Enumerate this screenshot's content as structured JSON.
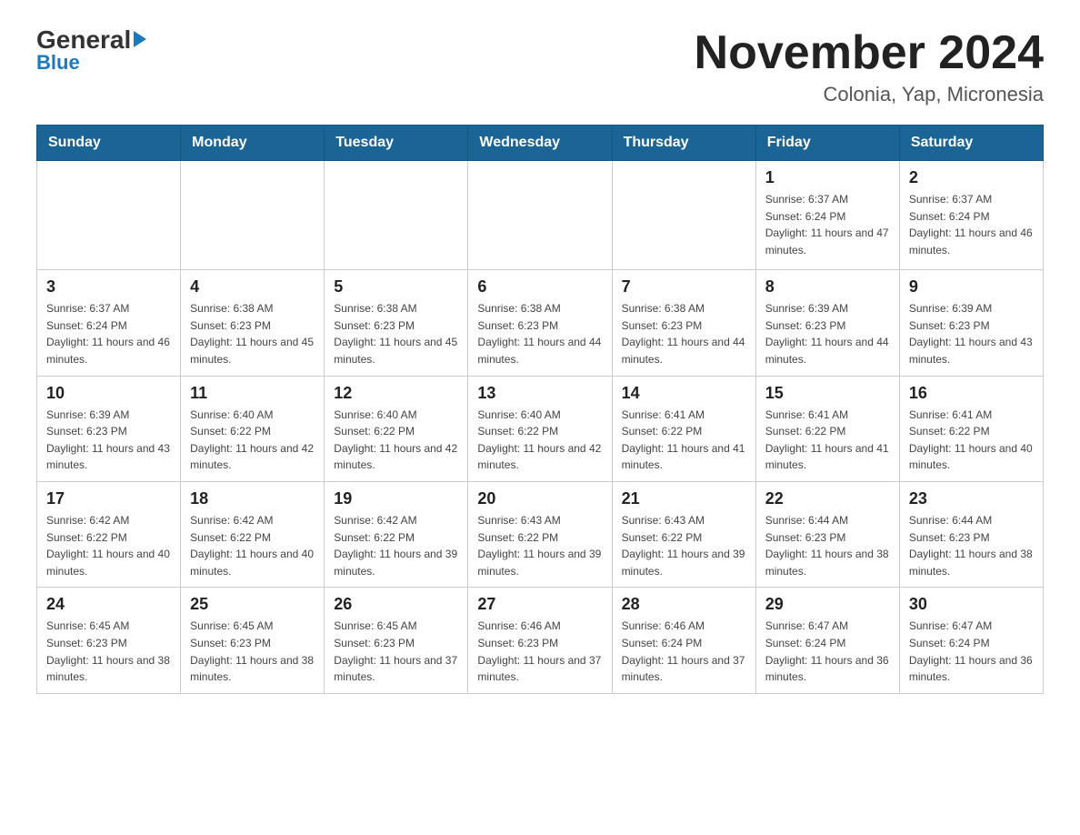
{
  "logo": {
    "general": "General",
    "blue": "Blue"
  },
  "title": "November 2024",
  "subtitle": "Colonia, Yap, Micronesia",
  "days_of_week": [
    "Sunday",
    "Monday",
    "Tuesday",
    "Wednesday",
    "Thursday",
    "Friday",
    "Saturday"
  ],
  "weeks": [
    [
      {
        "day": "",
        "info": ""
      },
      {
        "day": "",
        "info": ""
      },
      {
        "day": "",
        "info": ""
      },
      {
        "day": "",
        "info": ""
      },
      {
        "day": "",
        "info": ""
      },
      {
        "day": "1",
        "info": "Sunrise: 6:37 AM\nSunset: 6:24 PM\nDaylight: 11 hours and 47 minutes."
      },
      {
        "day": "2",
        "info": "Sunrise: 6:37 AM\nSunset: 6:24 PM\nDaylight: 11 hours and 46 minutes."
      }
    ],
    [
      {
        "day": "3",
        "info": "Sunrise: 6:37 AM\nSunset: 6:24 PM\nDaylight: 11 hours and 46 minutes."
      },
      {
        "day": "4",
        "info": "Sunrise: 6:38 AM\nSunset: 6:23 PM\nDaylight: 11 hours and 45 minutes."
      },
      {
        "day": "5",
        "info": "Sunrise: 6:38 AM\nSunset: 6:23 PM\nDaylight: 11 hours and 45 minutes."
      },
      {
        "day": "6",
        "info": "Sunrise: 6:38 AM\nSunset: 6:23 PM\nDaylight: 11 hours and 44 minutes."
      },
      {
        "day": "7",
        "info": "Sunrise: 6:38 AM\nSunset: 6:23 PM\nDaylight: 11 hours and 44 minutes."
      },
      {
        "day": "8",
        "info": "Sunrise: 6:39 AM\nSunset: 6:23 PM\nDaylight: 11 hours and 44 minutes."
      },
      {
        "day": "9",
        "info": "Sunrise: 6:39 AM\nSunset: 6:23 PM\nDaylight: 11 hours and 43 minutes."
      }
    ],
    [
      {
        "day": "10",
        "info": "Sunrise: 6:39 AM\nSunset: 6:23 PM\nDaylight: 11 hours and 43 minutes."
      },
      {
        "day": "11",
        "info": "Sunrise: 6:40 AM\nSunset: 6:22 PM\nDaylight: 11 hours and 42 minutes."
      },
      {
        "day": "12",
        "info": "Sunrise: 6:40 AM\nSunset: 6:22 PM\nDaylight: 11 hours and 42 minutes."
      },
      {
        "day": "13",
        "info": "Sunrise: 6:40 AM\nSunset: 6:22 PM\nDaylight: 11 hours and 42 minutes."
      },
      {
        "day": "14",
        "info": "Sunrise: 6:41 AM\nSunset: 6:22 PM\nDaylight: 11 hours and 41 minutes."
      },
      {
        "day": "15",
        "info": "Sunrise: 6:41 AM\nSunset: 6:22 PM\nDaylight: 11 hours and 41 minutes."
      },
      {
        "day": "16",
        "info": "Sunrise: 6:41 AM\nSunset: 6:22 PM\nDaylight: 11 hours and 40 minutes."
      }
    ],
    [
      {
        "day": "17",
        "info": "Sunrise: 6:42 AM\nSunset: 6:22 PM\nDaylight: 11 hours and 40 minutes."
      },
      {
        "day": "18",
        "info": "Sunrise: 6:42 AM\nSunset: 6:22 PM\nDaylight: 11 hours and 40 minutes."
      },
      {
        "day": "19",
        "info": "Sunrise: 6:42 AM\nSunset: 6:22 PM\nDaylight: 11 hours and 39 minutes."
      },
      {
        "day": "20",
        "info": "Sunrise: 6:43 AM\nSunset: 6:22 PM\nDaylight: 11 hours and 39 minutes."
      },
      {
        "day": "21",
        "info": "Sunrise: 6:43 AM\nSunset: 6:22 PM\nDaylight: 11 hours and 39 minutes."
      },
      {
        "day": "22",
        "info": "Sunrise: 6:44 AM\nSunset: 6:23 PM\nDaylight: 11 hours and 38 minutes."
      },
      {
        "day": "23",
        "info": "Sunrise: 6:44 AM\nSunset: 6:23 PM\nDaylight: 11 hours and 38 minutes."
      }
    ],
    [
      {
        "day": "24",
        "info": "Sunrise: 6:45 AM\nSunset: 6:23 PM\nDaylight: 11 hours and 38 minutes."
      },
      {
        "day": "25",
        "info": "Sunrise: 6:45 AM\nSunset: 6:23 PM\nDaylight: 11 hours and 38 minutes."
      },
      {
        "day": "26",
        "info": "Sunrise: 6:45 AM\nSunset: 6:23 PM\nDaylight: 11 hours and 37 minutes."
      },
      {
        "day": "27",
        "info": "Sunrise: 6:46 AM\nSunset: 6:23 PM\nDaylight: 11 hours and 37 minutes."
      },
      {
        "day": "28",
        "info": "Sunrise: 6:46 AM\nSunset: 6:24 PM\nDaylight: 11 hours and 37 minutes."
      },
      {
        "day": "29",
        "info": "Sunrise: 6:47 AM\nSunset: 6:24 PM\nDaylight: 11 hours and 36 minutes."
      },
      {
        "day": "30",
        "info": "Sunrise: 6:47 AM\nSunset: 6:24 PM\nDaylight: 11 hours and 36 minutes."
      }
    ]
  ]
}
